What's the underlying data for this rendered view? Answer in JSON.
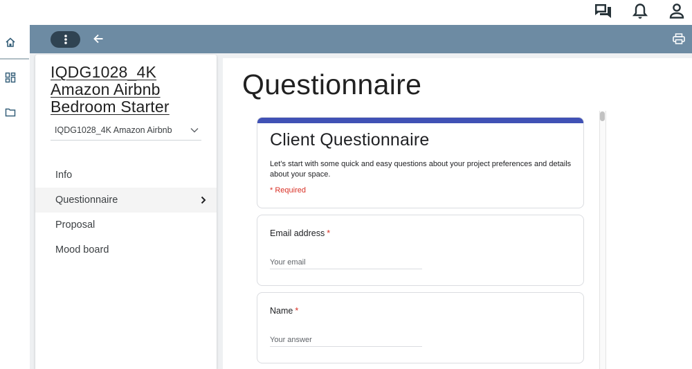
{
  "colors": {
    "header_band": "#6d8ba3",
    "menu_pill": "#2f4352",
    "form_accent": "#4051b5",
    "required": "#d93025"
  },
  "top_bar": {
    "icons": [
      "forum-icon",
      "bell-icon",
      "person-icon"
    ]
  },
  "rail": {
    "icons": [
      "home-icon",
      "dashboard-icon",
      "folder-icon"
    ]
  },
  "header": {
    "icons": [
      "more-vert-icon",
      "arrow-back-icon",
      "print-icon"
    ]
  },
  "panel": {
    "project_title": "IQDG1028_4K Amazon Airbnb Bedroom Starter",
    "project_select_value": "IQDG1028_4K Amazon Airbnb",
    "nav": [
      {
        "label": "Info"
      },
      {
        "label": "Questionnaire",
        "active": true
      },
      {
        "label": "Proposal"
      },
      {
        "label": "Mood board"
      }
    ]
  },
  "main": {
    "page_title": "Questionnaire",
    "form": {
      "title": "Client Questionnaire",
      "description": "Let’s start with some quick and easy questions about your project preferences and details about your space.",
      "required_note": "* Required",
      "questions": [
        {
          "label": "Email address",
          "required_mark": "*",
          "placeholder": "Your email"
        },
        {
          "label": "Name",
          "required_mark": "*",
          "placeholder": "Your answer"
        }
      ]
    }
  }
}
